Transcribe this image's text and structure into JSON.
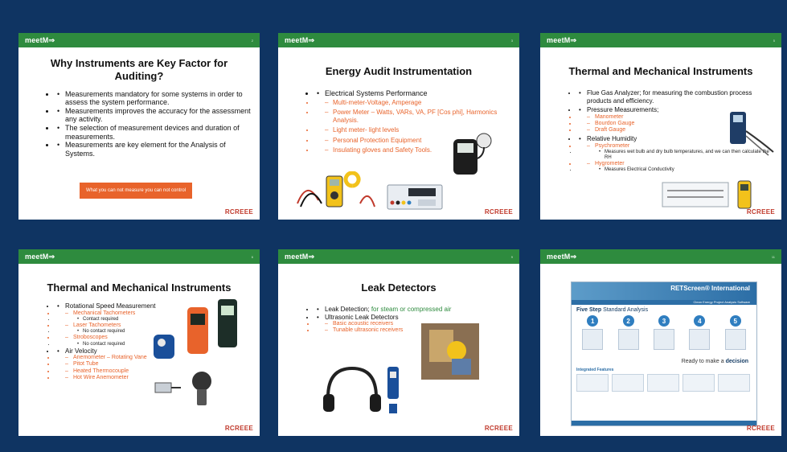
{
  "brand": {
    "logo": "meetM⇒",
    "footer": "RCREEE"
  },
  "colors": {
    "background": "#0f3462",
    "topbar": "#2e8b3e",
    "accent": "#e8632b"
  },
  "slides": [
    {
      "page": "2",
      "title": "Why Instruments are Key Factor for Auditing?",
      "bullets": [
        "Measurements mandatory for some systems in order to assess the system performance.",
        "Measurements improves the accuracy for the assessment any activity.",
        "The selection of measurement devices and duration of measurements.",
        "Measurements are key element for the Analysis of Systems."
      ],
      "callout": "What you can not measure you can not control"
    },
    {
      "page": "3",
      "title": "Energy Audit Instrumentation",
      "bullet": "Electrical Systems Performance",
      "subs": [
        "Multi-meter-Voltage, Amperage",
        "Power Meter – Watts, VARs, VA, PF [Cos phi], Harmonics Analysis.",
        "Light meter- light levels",
        "Personal Protection Equipment",
        "Insulating gloves and Safety Tools."
      ]
    },
    {
      "page": "5",
      "title": "Thermal and Mechanical Instruments",
      "b1": "Flue Gas Analyzer; for measuring the combustion process products and efficiency.",
      "b2": "Pressure Measurements;",
      "b2_subs": [
        "Manometer",
        "Bourdon Gauge",
        "Draft Gauge"
      ],
      "b3": "Relative Humidity",
      "psy": "Psychrometer",
      "psy_note": "Measures wet bulb and dry bulb temperatures, and we can then calculate the RH",
      "hyg": "Hygrometer",
      "hyg_note": "Measures Electrical Conductivity"
    },
    {
      "page": "6",
      "title": "Thermal and Mechanical Instruments",
      "b1": "Rotational Speed Measurement",
      "mech": "Mechanical Tachometers",
      "mech_note": "Contact required",
      "laser": "Laser Tachometers",
      "laser_note": "No contact required",
      "strobo": "Stroboscopes",
      "strobo_note": "No contact required",
      "b2": "Air Velocity",
      "air_subs": [
        "Anemometer – Rotating Vane",
        "Pitot Tube",
        "Heated Thermocouple",
        "Hot Wire Anemometer"
      ]
    },
    {
      "page": "9",
      "title": "Leak Detectors",
      "b1": "Leak Detection;",
      "b1_green": " for steam or compressed air",
      "b2": "Ultrasonic Leak Detectors",
      "subs": [
        "Basic acoustic receivers",
        "Tunable ultrasonic receivers"
      ]
    },
    {
      "page": "11",
      "rets_title": "RETScreen® International",
      "rets_sub": "Clean Energy Project Analysis Software",
      "heading_a": "Five Step",
      "heading_b": "Standard Analysis",
      "steps": [
        "1",
        "2",
        "3",
        "4",
        "5"
      ],
      "decision_a": "Ready to make a ",
      "decision_b": "decision",
      "integrated": "Integrated Features"
    }
  ]
}
